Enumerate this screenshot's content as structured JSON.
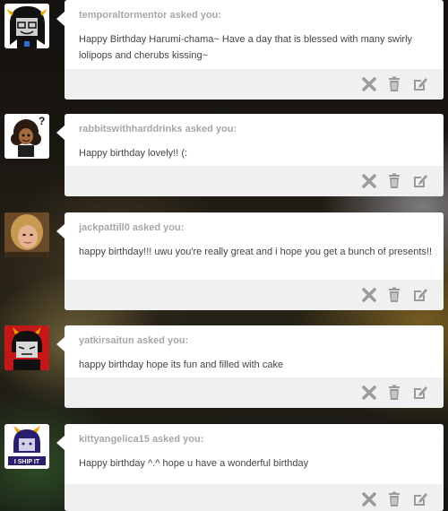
{
  "posts": [
    {
      "asker": "temporaltormentor",
      "asked_suffix": "asked you:",
      "question": "Happy Birthday Harumi-chama~ Have a day that is blessed with many swirly lolipops and cherubs kissing~",
      "avatar_icon": "troll-girl-avatar"
    },
    {
      "asker": "rabbitswithharddrinks",
      "asked_suffix": "asked you:",
      "question": "Happy birthday lovely!! (:",
      "avatar_icon": "curly-hair-cartoon-avatar"
    },
    {
      "asker": "jackpattill0",
      "asked_suffix": "asked you:",
      "question": "happy birthday!!! uwu you're really great and i hope you get a bunch of presents!!",
      "avatar_icon": "photo-avatar"
    },
    {
      "asker": "yatkirsaitun",
      "asked_suffix": "asked you:",
      "question": "happy birthday hope its fun and filled with cake",
      "avatar_icon": "karkat-avatar"
    },
    {
      "asker": "kittyangelica15",
      "asked_suffix": "asked you:",
      "question": "Happy birthday ^.^ hope u have a wonderful birthday",
      "avatar_icon": "i-ship-it-avatar",
      "avatar_text": "I SHIP IT"
    }
  ],
  "colors": {
    "card_bg": "#ffffff",
    "footer_bg": "#f0f0f0",
    "asker_text": "#a7a7a7",
    "body_text": "#444444",
    "control_icon": "#9a9a9a"
  }
}
